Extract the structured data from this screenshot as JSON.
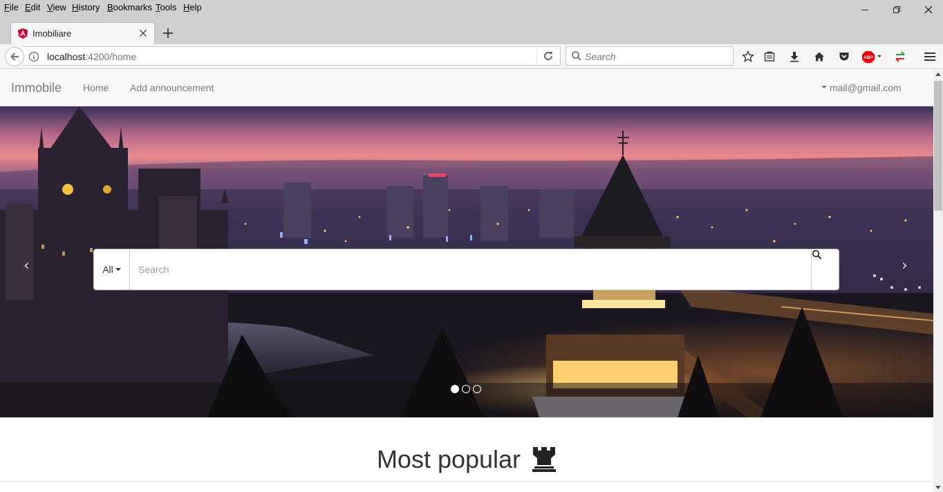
{
  "browser": {
    "menu": [
      "File",
      "Edit",
      "View",
      "History",
      "Bookmarks",
      "Tools",
      "Help"
    ],
    "tab_title": "Imobiliare",
    "url_host": "localhost",
    "url_rest": ":4200/home",
    "search_placeholder": "Search",
    "icons": [
      "back-icon",
      "info-icon",
      "reload-icon",
      "search-icon",
      "bookmark-star-icon",
      "reader-icon",
      "download-icon",
      "home-icon",
      "pocket-icon",
      "adblock-icon",
      "extension-arrows-icon",
      "hamburger-menu-icon"
    ]
  },
  "site": {
    "brand": "Immobile",
    "nav": {
      "home": "Home",
      "add": "Add announcement"
    },
    "user_email": "mail@gmail.com"
  },
  "hero": {
    "prev_label": "‹",
    "next_label": "›",
    "search": {
      "type_selected": "All",
      "placeholder": "Search"
    },
    "slides_total": 3,
    "active_slide": 1
  },
  "section": {
    "title": "Most popular"
  },
  "colors": {
    "accent_red": "#dd0031",
    "nav_text": "#777777",
    "sky_top": "#3a2f5a",
    "sky_glow": "#e88a8a"
  }
}
